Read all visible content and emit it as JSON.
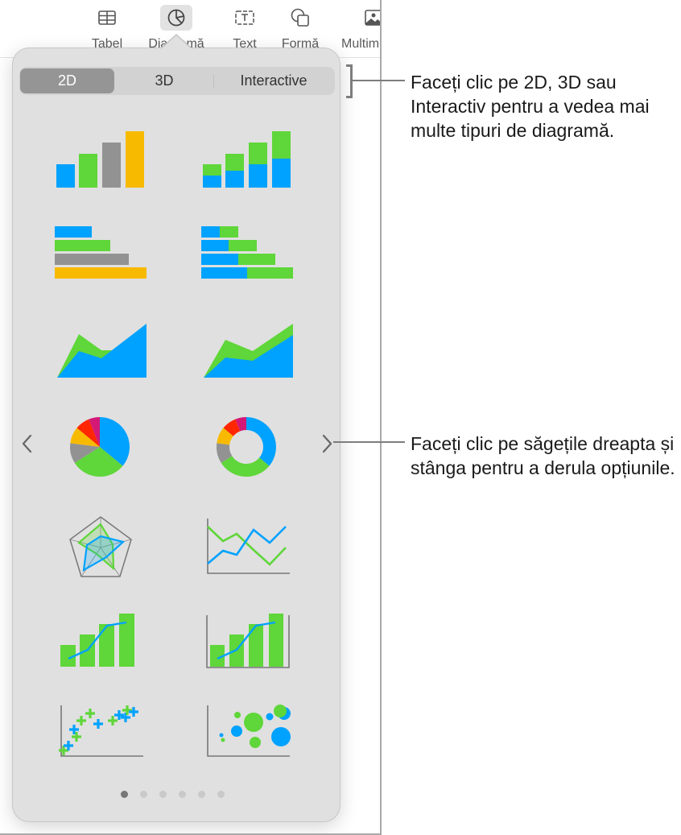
{
  "toolbar": {
    "items": [
      {
        "label": "Tabel",
        "icon": "table-icon"
      },
      {
        "label": "Diagramă",
        "icon": "chart-pie-icon",
        "active": true
      },
      {
        "label": "Text",
        "icon": "text-box-icon"
      },
      {
        "label": "Formă",
        "icon": "shape-icon"
      },
      {
        "label": "Multimedia",
        "icon": "media-icon"
      }
    ]
  },
  "popover": {
    "tabs": [
      {
        "label": "2D",
        "selected": true
      },
      {
        "label": "3D",
        "selected": false
      },
      {
        "label": "Interactive",
        "selected": false
      }
    ],
    "chart_types": [
      {
        "name": "column"
      },
      {
        "name": "stacked-column"
      },
      {
        "name": "bar"
      },
      {
        "name": "stacked-bar"
      },
      {
        "name": "area"
      },
      {
        "name": "stacked-area"
      },
      {
        "name": "pie"
      },
      {
        "name": "donut"
      },
      {
        "name": "radar"
      },
      {
        "name": "line"
      },
      {
        "name": "mixed"
      },
      {
        "name": "two-axis"
      },
      {
        "name": "scatter"
      },
      {
        "name": "bubble"
      }
    ],
    "nav": {
      "prev_icon": "chevron-left-icon",
      "next_icon": "chevron-right-icon"
    },
    "pagination": {
      "total_pages": 6,
      "current_page": 1
    }
  },
  "colors": {
    "blue": "#00a2ff",
    "green": "#5fd639",
    "gray": "#929292",
    "yellow": "#f8ba00",
    "red": "#ff2600",
    "magenta": "#d31876"
  },
  "callouts": [
    {
      "text": "Faceți clic pe 2D, 3D sau Interactiv pentru a vedea mai multe tipuri de diagramă."
    },
    {
      "text": "Faceți clic pe săgețile dreapta și stânga pentru a derula opțiunile."
    }
  ]
}
